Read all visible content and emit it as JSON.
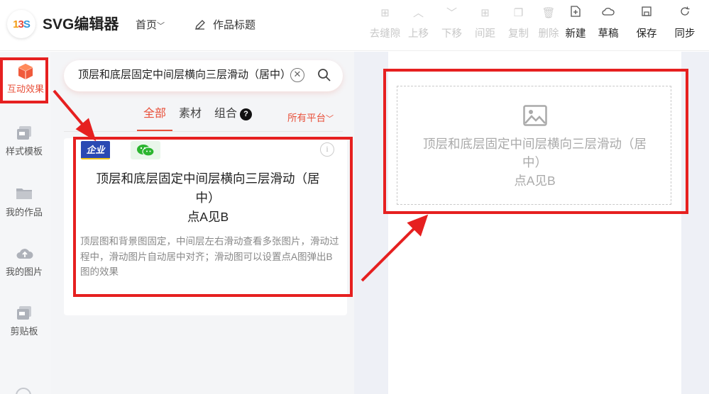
{
  "header": {
    "logo_text": "13S",
    "app_title": "SVG编辑器",
    "home_label": "首页",
    "doc_title": "作品标题",
    "toolbar": [
      {
        "label": "去缝隙",
        "icon": "gap-icon",
        "enabled": false
      },
      {
        "label": "上移",
        "icon": "up-icon",
        "enabled": false
      },
      {
        "label": "下移",
        "icon": "down-icon",
        "enabled": false
      },
      {
        "label": "间距",
        "icon": "spacing-icon",
        "enabled": false
      },
      {
        "label": "复制",
        "icon": "copy-icon",
        "enabled": false
      },
      {
        "label": "删除",
        "icon": "delete-icon",
        "enabled": false
      },
      {
        "label": "新建",
        "icon": "new-file-icon",
        "enabled": true
      },
      {
        "label": "草稿",
        "icon": "cloud-icon",
        "enabled": true
      },
      {
        "label": "保存",
        "icon": "save-icon",
        "enabled": true
      },
      {
        "label": "同步",
        "icon": "sync-icon",
        "enabled": true
      }
    ]
  },
  "nav": {
    "items": [
      {
        "label": "互动效果",
        "icon": "cube-icon",
        "active": true
      },
      {
        "label": "样式模板",
        "icon": "template-icon"
      },
      {
        "label": "我的作品",
        "icon": "folder-icon"
      },
      {
        "label": "我的图片",
        "icon": "cloud-upload-icon"
      },
      {
        "label": "剪贴板",
        "icon": "clipboard-icon"
      }
    ]
  },
  "panel": {
    "search_value": "顶层和底层固定中间层横向三层滑动（居中）",
    "tabs": [
      {
        "label": "全部",
        "active": true
      },
      {
        "label": "素材"
      },
      {
        "label": "组合"
      }
    ],
    "help_mark": "?",
    "platform_label": "所有平台",
    "card": {
      "badge_enterprise": "企业",
      "title_line1": "顶层和底层固定中间层横向三层滑动（居",
      "title_line2": "中）",
      "title_line3": "点A见B",
      "description": "顶层图和背景图固定，中间层左右滑动查看多张图片，滑动过程中，滑动图片自动居中对齐；滑动图可以设置点A图弹出B图的效果"
    }
  },
  "canvas": {
    "preview_line1": "顶层和底层固定中间层横向三层滑动（居",
    "preview_line2": "中）",
    "preview_line3": "点A见B"
  },
  "colors": {
    "accent": "#e8503a",
    "annotation": "#e62020"
  }
}
